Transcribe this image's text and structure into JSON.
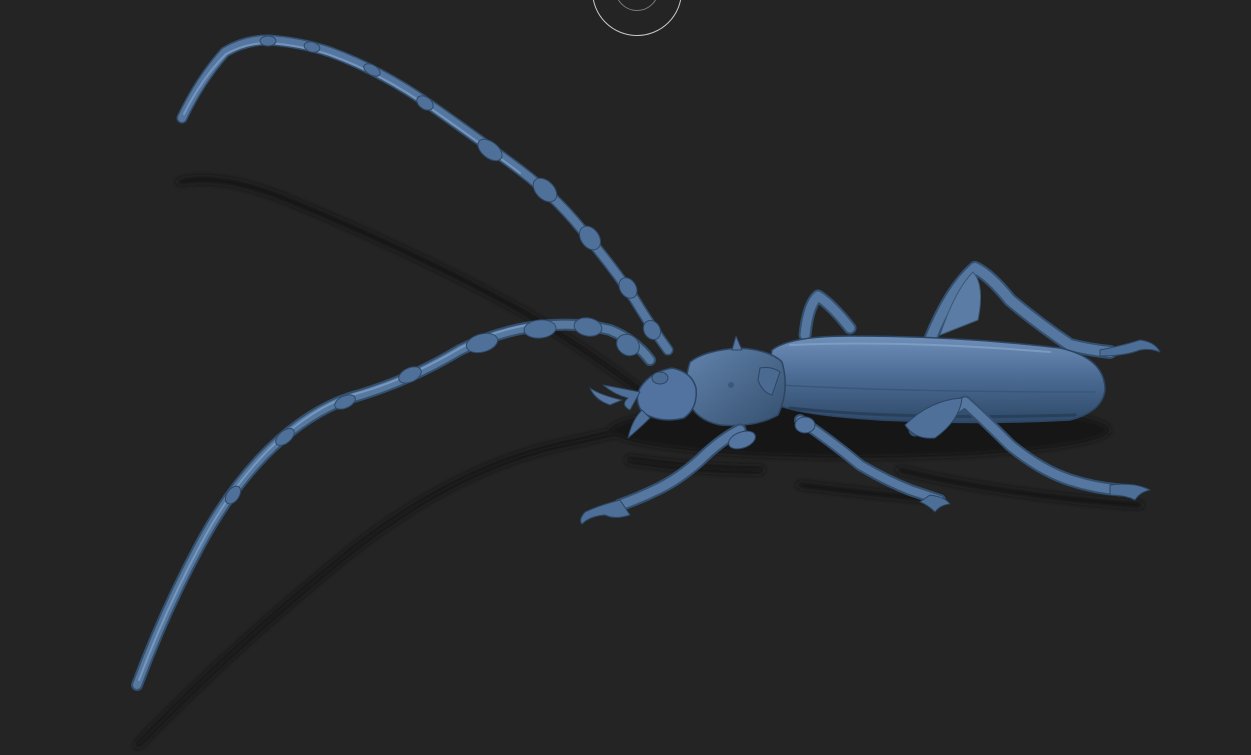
{
  "viewport": {
    "background": "#242424",
    "model_color": "#4a6a93",
    "model_dark": "#34506f",
    "model_light": "#6a8ab3",
    "shadow_color": "#121212",
    "gizmo_color": "#c9c9c9"
  },
  "scene": {
    "model_name": "longhorn-beetle-sculpt",
    "shading": "matcap"
  },
  "gizmo": {
    "icon": "orbit-rotate-icon"
  }
}
